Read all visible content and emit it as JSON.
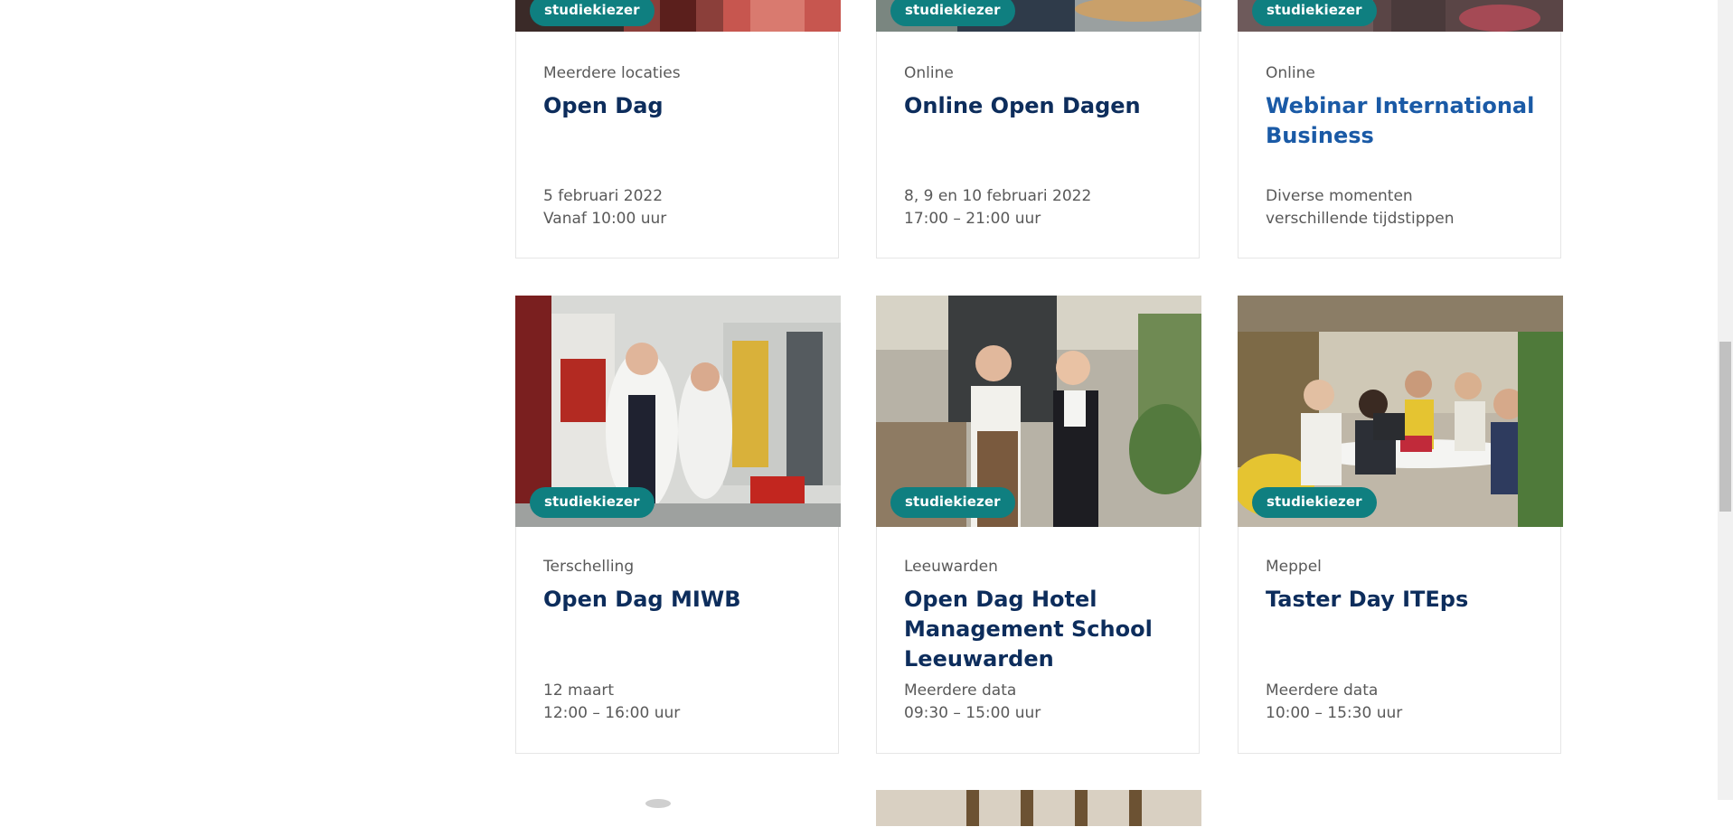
{
  "cards": [
    {
      "badge": "studiekiezer",
      "location": "Meerdere locaties",
      "title": "Open Dag",
      "date": "5 februari 2022",
      "time": "Vanaf 10:00 uur"
    },
    {
      "badge": "studiekiezer",
      "location": "Online",
      "title": "Online Open Dagen",
      "date": "8, 9 en 10 februari 2022",
      "time": "17:00 – 21:00 uur"
    },
    {
      "badge": "studiekiezer",
      "location": "Online",
      "title": "Webinar International Business",
      "date": "Diverse momenten",
      "time": "verschillende tijdstippen"
    },
    {
      "badge": "studiekiezer",
      "location": "Terschelling",
      "title": "Open Dag MIWB",
      "date": "12 maart",
      "time": "12:00 – 16:00 uur"
    },
    {
      "badge": "studiekiezer",
      "location": "Leeuwarden",
      "title": "Open Dag Hotel Management School Leeuwarden",
      "date": "Meerdere data",
      "time": "09:30 – 15:00 uur"
    },
    {
      "badge": "studiekiezer",
      "location": "Meppel",
      "title": "Taster Day ITEps",
      "date": "Meerdere data",
      "time": "10:00 – 15:30 uur"
    }
  ],
  "colors": {
    "badge": "#0f7f80",
    "title": "#0d2d5c",
    "title_link": "#1a5aa6"
  }
}
